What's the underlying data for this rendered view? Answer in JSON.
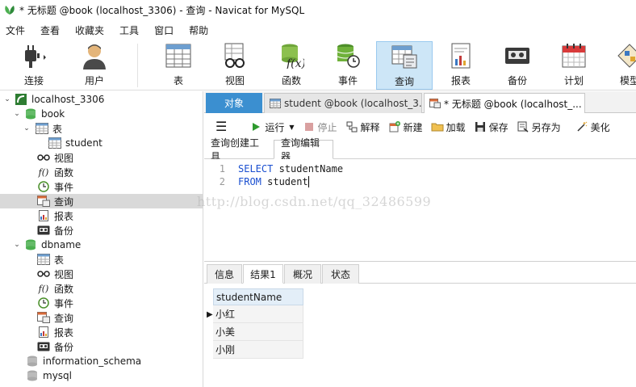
{
  "window": {
    "title": "* 无标题 @book (localhost_3306) - 查询 - Navicat for MySQL"
  },
  "menu": [
    "文件",
    "查看",
    "收藏夹",
    "工具",
    "窗口",
    "帮助"
  ],
  "toolbar": {
    "connect": "连接",
    "user": "用户",
    "table": "表",
    "view": "视图",
    "function": "函数",
    "event": "事件",
    "query": "查询",
    "report": "报表",
    "backup": "备份",
    "schedule": "计划",
    "model": "模型"
  },
  "tree": {
    "connection": "localhost_3306",
    "book": "book",
    "book_tables": "表",
    "student": "student",
    "book_views": "视图",
    "book_functions": "函数",
    "book_events": "事件",
    "book_queries": "查询",
    "book_reports": "报表",
    "book_backups": "备份",
    "dbname": "dbname",
    "db_tables": "表",
    "db_views": "视图",
    "db_functions": "函数",
    "db_events": "事件",
    "db_queries": "查询",
    "db_reports": "报表",
    "db_backups": "备份",
    "information_schema": "information_schema",
    "mysql": "mysql"
  },
  "tabs": {
    "objects": "对象",
    "student_tab": "student @book (localhost_3...",
    "query_tab": "* 无标题 @book (localhost_..."
  },
  "query_toolbar": {
    "run": "运行",
    "stop": "停止",
    "explain": "解释",
    "new": "新建",
    "load": "加载",
    "save": "保存",
    "save_as": "另存为",
    "beautify": "美化"
  },
  "subtabs": {
    "builder": "查询创建工具",
    "editor": "查询编辑器"
  },
  "editor": {
    "lines": [
      {
        "num": "1",
        "kw": "SELECT",
        "rest": " studentName"
      },
      {
        "num": "2",
        "kw": "FROM",
        "rest": " student"
      }
    ]
  },
  "watermark": "http://blog.csdn.net/qq_32486599",
  "result_tabs": [
    "信息",
    "结果1",
    "概况",
    "状态"
  ],
  "result": {
    "column": "studentName",
    "rows": [
      "小红",
      "小美",
      "小刚"
    ]
  }
}
